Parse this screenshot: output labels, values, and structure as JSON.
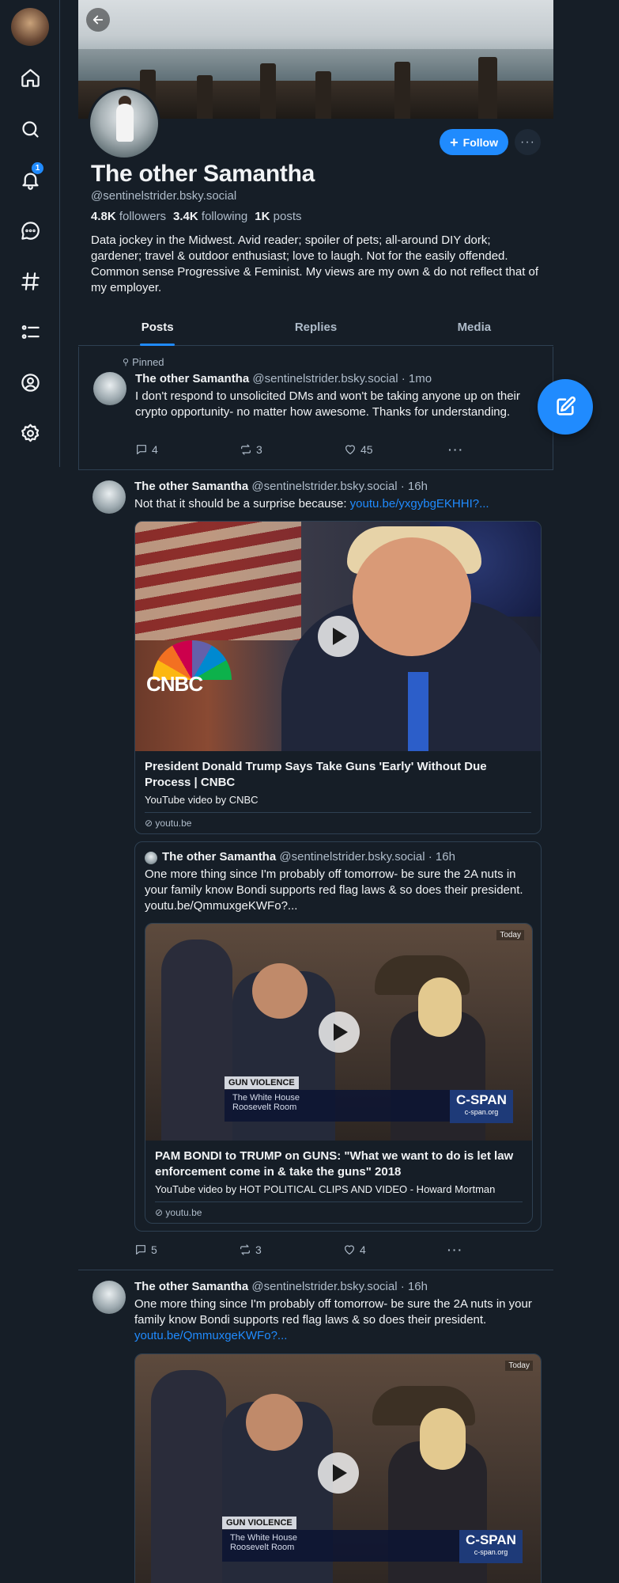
{
  "nav": {
    "items": [
      "home-icon",
      "search-icon",
      "notifications-icon",
      "chat-icon",
      "feeds-icon",
      "lists-icon",
      "profile-icon",
      "settings-icon"
    ],
    "notifications_badge": "1"
  },
  "profile": {
    "name": "The other Samantha",
    "handle": "@sentinelstrider.bsky.social",
    "followers_count": "4.8K",
    "followers_label": "followers",
    "following_count": "3.4K",
    "following_label": "following",
    "posts_count": "1K",
    "posts_label": "posts",
    "bio": "Data jockey in the Midwest. Avid reader; spoiler of pets; all-around DIY dork; gardener; travel & outdoor enthusiast; love to laugh. Not for the easily offended. Common sense Progressive & Feminist. My views are my own & do not reflect that of my employer.",
    "follow_label": "Follow",
    "more_label": "···"
  },
  "tabs": [
    "Posts",
    "Replies",
    "Media"
  ],
  "pinned_label": "Pinned",
  "posts": [
    {
      "author": "The other Samantha",
      "handle": "@sentinelstrider.bsky.social",
      "time": "· 1mo",
      "text": "I don't respond to unsolicited DMs and won't be taking anyone up on their crypto opportunity- no matter how awesome. Thanks for understanding.",
      "replies": "4",
      "reposts": "3",
      "likes": "45"
    },
    {
      "author": "The other Samantha",
      "handle": "@sentinelstrider.bsky.social",
      "time": "· 16h",
      "text": "Not that it should be a surprise because: ",
      "link": "youtu.be/yxgybgEKHHI?...",
      "embed": {
        "title": "President Donald Trump Says Take Guns 'Early' Without Due Process | CNBC",
        "desc": "YouTube video by CNBC",
        "domain": "youtu.be",
        "logo": "CNBC"
      },
      "quote": {
        "author": "The other Samantha",
        "handle": "@sentinelstrider.bsky.social",
        "time": "· 16h",
        "text": "One more thing since I'm probably off tomorrow- be sure the 2A nuts in your family know Bondi supports red flag laws & so does their president. youtu.be/QmmuxgeKWFo?...",
        "embed": {
          "title": "PAM BONDI to TRUMP on GUNS: \"What we want to do is let law enforcement come in & take the guns\" 2018",
          "desc": "YouTube video by HOT POLITICAL CLIPS AND VIDEO - Howard Mortman",
          "domain": "youtu.be",
          "tag": "GUN VIOLENCE",
          "location1": "The White House",
          "location2": "Roosevelt Room",
          "network": "C-SPAN",
          "network_sub": "c-span.org",
          "today": "Today"
        }
      },
      "replies": "5",
      "reposts": "3",
      "likes": "4"
    },
    {
      "author": "The other Samantha",
      "handle": "@sentinelstrider.bsky.social",
      "time": "· 16h",
      "text": "One more thing since I'm probably off tomorrow- be sure the 2A nuts in your family know Bondi supports red flag laws & so does their president. ",
      "link": "youtu.be/QmmuxgeKWFo?...",
      "embed": {
        "tag": "GUN VIOLENCE",
        "location1": "The White House",
        "location2": "Roosevelt Room",
        "network": "C-SPAN",
        "network_sub": "c-span.org",
        "today": "Today"
      }
    }
  ],
  "colors": {
    "accent": "#208bfe",
    "background": "#161e27",
    "border": "#2e4052",
    "muted": "#aebbc9"
  }
}
